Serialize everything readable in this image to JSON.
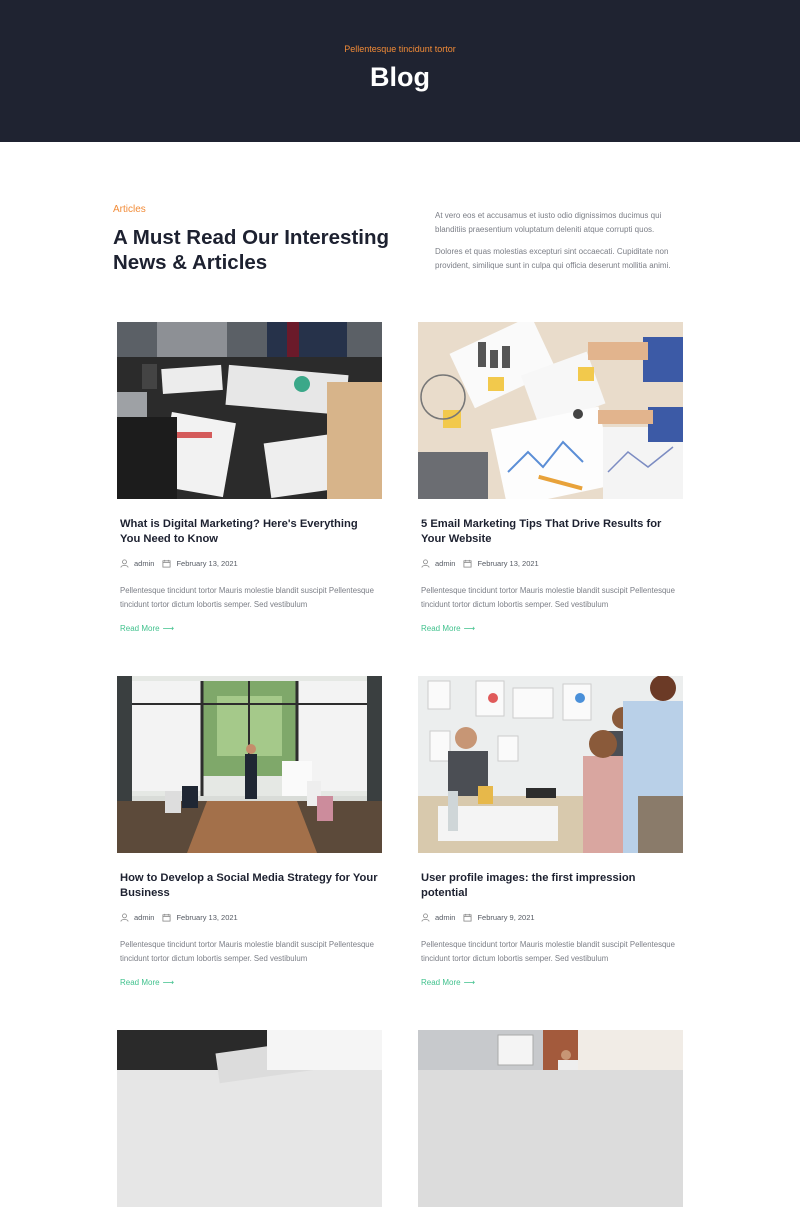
{
  "hero": {
    "eyebrow": "Pellentesque tincidunt tortor",
    "title": "Blog",
    "background_color": "#1f2331",
    "accent_color": "#f28b37"
  },
  "intro": {
    "eyebrow": "Articles",
    "title": "A Must Read Our Interesting News & Articles",
    "paragraphs": [
      "At vero eos et accusamus et iusto odio dignissimos ducimus qui blanditiis praesentium voluptatum deleniti atque corrupti quos.",
      "Dolores et quas molestias excepturi sint occaecati. Cupiditate non provident, similique sunt in culpa qui officia deserunt mollitia animi."
    ]
  },
  "icons": {
    "author": "user-icon",
    "date": "calendar-icon",
    "read_more": "arrow-right-icon"
  },
  "read_more_color": "#42c28e",
  "posts": [
    {
      "title": "What is Digital Marketing? Here's Everything You Need to Know",
      "author": "admin",
      "date": "February 13, 2021",
      "excerpt": "Pellentesque tincidunt tortor Mauris molestie blandit suscipit Pellentesque tincidunt tortor dictum lobortis semper. Sed vestibulum",
      "read_more": "Read More",
      "arrow": "⟶"
    },
    {
      "title": "5 Email Marketing Tips That Drive Results for Your Website",
      "author": "admin",
      "date": "February 13, 2021",
      "excerpt": "Pellentesque tincidunt tortor Mauris molestie blandit suscipit Pellentesque tincidunt tortor dictum lobortis semper. Sed vestibulum",
      "read_more": "Read More",
      "arrow": "⟶"
    },
    {
      "title": "How to Develop a Social Media Strategy for Your Business",
      "author": "admin",
      "date": "February 13, 2021",
      "excerpt": "Pellentesque tincidunt tortor Mauris molestie blandit suscipit Pellentesque tincidunt tortor dictum lobortis semper. Sed vestibulum",
      "read_more": "Read More",
      "arrow": "⟶"
    },
    {
      "title": "User profile images: the first impression potential",
      "author": "admin",
      "date": "February 9, 2021",
      "excerpt": "Pellentesque tincidunt tortor Mauris molestie blandit suscipit Pellentesque tincidunt tortor dictum lobortis semper. Sed vestibulum",
      "read_more": "Read More",
      "arrow": "⟶"
    }
  ]
}
